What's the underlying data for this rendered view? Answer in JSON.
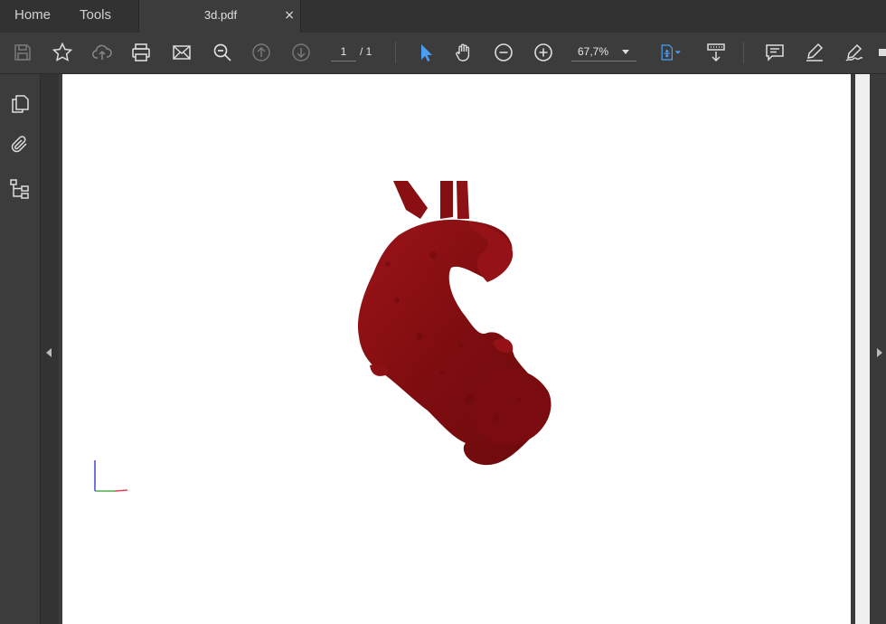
{
  "tabs": {
    "home_label": "Home",
    "tools_label": "Tools",
    "document_title": "3d.pdf",
    "close_glyph": "×"
  },
  "toolbar": {
    "icons": [
      "save-icon",
      "bookmark-star-icon",
      "upload-cloud-icon",
      "print-icon",
      "email-icon",
      "search-zoom-icon",
      "previous-page-icon",
      "next-page-icon",
      "select-arrow-icon",
      "hand-tool-icon",
      "zoom-out-icon",
      "zoom-in-icon",
      "fit-page-icon",
      "scroll-mode-icon",
      "comment-icon",
      "highlight-icon",
      "sign-icon"
    ],
    "current_page": "1",
    "total_pages": "/ 1",
    "zoom_value": "67,7%"
  },
  "left_rail": {
    "icons": [
      "pages-icon",
      "attachment-icon",
      "structure-tree-icon"
    ]
  },
  "colors": {
    "accent": "#4a9ff5",
    "model_red": "#8b0f12",
    "app_bg": "#3c3c3c"
  }
}
